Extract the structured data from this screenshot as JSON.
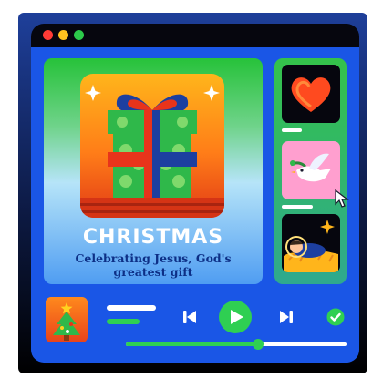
{
  "window": {
    "controls": [
      "close-dot",
      "minimize-dot",
      "maximize-dot"
    ],
    "colors": {
      "close": "#ff3b36",
      "minimize": "#ffc21f",
      "maximize": "#2cc94a",
      "window_bg": "#1a56e6"
    }
  },
  "hero": {
    "title": "CHRISTMAS",
    "subtitle": "Celebrating Jesus, God's greatest gift",
    "artwork": "gift-icon"
  },
  "playlist": {
    "items": [
      {
        "icon": "heart-icon"
      },
      {
        "icon": "dove-icon"
      },
      {
        "icon": "nativity-icon"
      }
    ]
  },
  "player": {
    "now_playing_icon": "christmas-tree-icon",
    "controls": [
      "skip-previous-icon",
      "play-icon",
      "skip-next-icon",
      "check-icon"
    ],
    "progress": 0.6,
    "accent": "#2fcf52"
  }
}
